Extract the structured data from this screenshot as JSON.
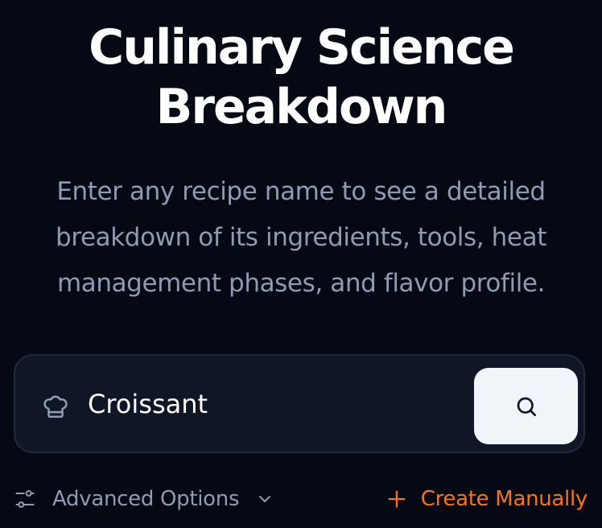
{
  "header": {
    "title_line1": "Culinary Science",
    "title_line2": "Breakdown",
    "subtitle": "Enter any recipe name to see a detailed breakdown of its ingredients, tools, heat management phases, and flavor profile."
  },
  "search": {
    "value": "Croissant",
    "icon": "chef-hat-icon",
    "button_icon": "search-icon"
  },
  "options": {
    "advanced_label": "Advanced Options",
    "advanced_icon": "sliders-icon",
    "create_label": "Create Manually",
    "create_icon": "plus-icon"
  },
  "colors": {
    "background": "#050914",
    "accent": "#f97316",
    "muted_text": "#8d9bb3",
    "search_button_bg": "#f1f5f9"
  }
}
